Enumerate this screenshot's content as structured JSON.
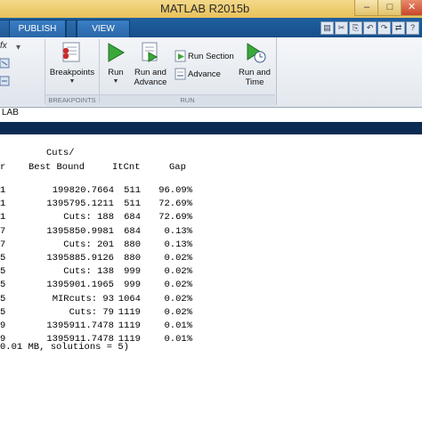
{
  "window": {
    "title": "MATLAB R2015b",
    "minimize": "–",
    "maximize": "□",
    "close": "✕"
  },
  "tabs": [
    {
      "label": ""
    },
    {
      "label": "PUBLISH"
    },
    {
      "label": "VIEW"
    }
  ],
  "ribbon": {
    "breakpoints": {
      "label": "Breakpoints",
      "group": "BREAKPOINTS"
    },
    "run": {
      "label": "Run"
    },
    "run_and_advance": {
      "line1": "Run and",
      "line2": "Advance"
    },
    "run_section": {
      "label": "Run Section"
    },
    "advance": {
      "label": "Advance"
    },
    "run_and_time": {
      "line1": "Run and",
      "line2": "Time"
    },
    "run_group": "RUN",
    "fx": "fx"
  },
  "address": "LAB",
  "console": {
    "header1": "Cuts/",
    "header2": {
      "col1": "r",
      "col2": "Best Bound",
      "col3": "ItCnt",
      "col4": "Gap"
    },
    "rows": [
      {
        "a": "1",
        "b": "199820.7664",
        "c": "511",
        "d": "96.09%"
      },
      {
        "a": "1",
        "b": "1395795.1211",
        "c": "511",
        "d": "72.69%"
      },
      {
        "a": "1",
        "b": "Cuts: 188",
        "c": "684",
        "d": "72.69%"
      },
      {
        "a": "7",
        "b": "1395850.9981",
        "c": "684",
        "d": "0.13%"
      },
      {
        "a": "7",
        "b": "Cuts: 201",
        "c": "880",
        "d": "0.13%"
      },
      {
        "a": "5",
        "b": "1395885.9126",
        "c": "880",
        "d": "0.02%"
      },
      {
        "a": "5",
        "b": "Cuts: 138",
        "c": "999",
        "d": "0.02%"
      },
      {
        "a": "5",
        "b": "1395901.1965",
        "c": "999",
        "d": "0.02%"
      },
      {
        "a": "5",
        "b": "MIRcuts: 93",
        "c": "1064",
        "d": "0.02%"
      },
      {
        "a": "5",
        "b": "Cuts: 79",
        "c": "1119",
        "d": "0.02%"
      },
      {
        "a": "9",
        "b": "1395911.7478",
        "c": "1119",
        "d": "0.01%"
      },
      {
        "a": "9",
        "b": "1395911.7478",
        "c": "1119",
        "d": "0.01%"
      }
    ],
    "footer": "0.01 MB, solutions = 5)"
  },
  "colors": {
    "titlebar": "#e8c15a",
    "tabrow": "#1f5fa0",
    "console_bg": "#ffffff"
  },
  "icons": {
    "breakpoints": "breakpoints-icon",
    "run": "run-icon",
    "run_and_advance": "run-advance-icon",
    "run_section": "run-section-icon",
    "advance": "advance-icon",
    "run_and_time": "run-time-icon"
  }
}
